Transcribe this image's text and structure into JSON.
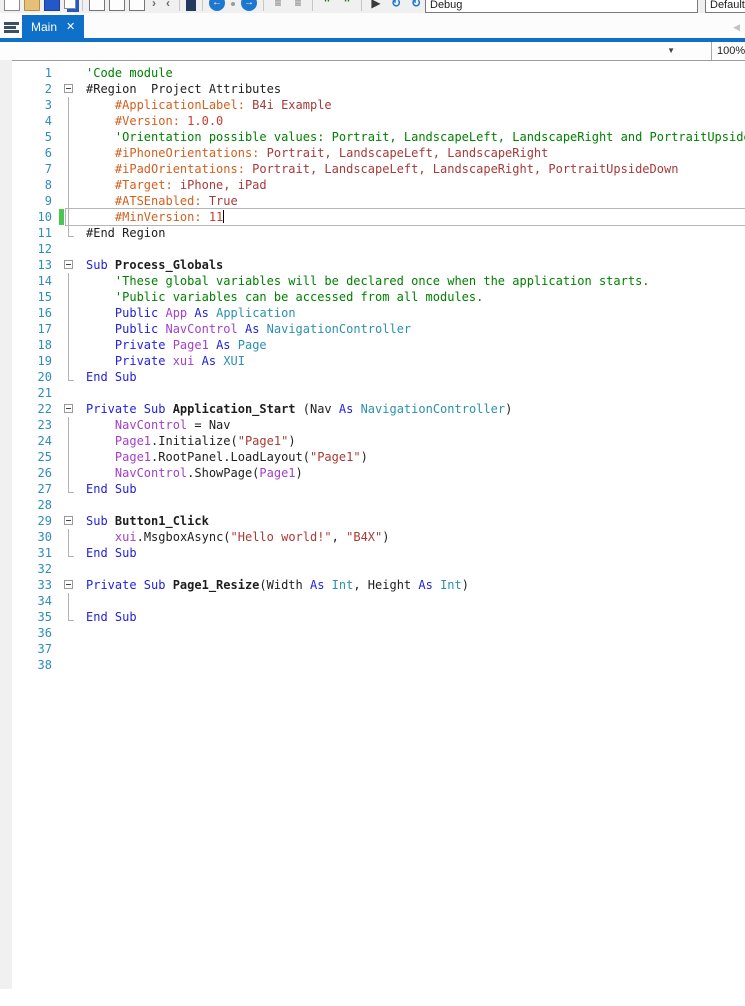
{
  "toolbar": {
    "debug_value": "Debug",
    "default_value": "Default",
    "icons": [
      {
        "name": "new-file",
        "kind": "square",
        "glyph": ""
      },
      {
        "name": "open-project",
        "kind": "folder",
        "glyph": ""
      },
      {
        "name": "save",
        "kind": "save",
        "glyph": ""
      },
      {
        "name": "save-all",
        "kind": "saveall",
        "glyph": ""
      },
      {
        "sep": true
      },
      {
        "name": "designer",
        "kind": "window",
        "glyph": ""
      },
      {
        "name": "modules",
        "kind": "window",
        "glyph": ""
      },
      {
        "name": "logs-panel",
        "kind": "window",
        "glyph": ""
      },
      {
        "name": "match-previous",
        "kind": "chev",
        "glyph": "›"
      },
      {
        "name": "match-next",
        "kind": "chev",
        "glyph": "‹"
      },
      {
        "sep": true
      },
      {
        "name": "bookmark",
        "kind": "bookmark",
        "glyph": ""
      },
      {
        "sep": true
      },
      {
        "name": "navigate-back",
        "kind": "bluecircle",
        "glyph": "←"
      },
      {
        "name": "navigate-dot",
        "kind": "dot",
        "glyph": ""
      },
      {
        "name": "navigate-forward",
        "kind": "bluecircle",
        "glyph": "→"
      },
      {
        "sep": true
      },
      {
        "name": "outdent",
        "kind": "plain",
        "glyph": "≡"
      },
      {
        "name": "indent",
        "kind": "plain",
        "glyph": "≡"
      },
      {
        "sep": true
      },
      {
        "name": "comment",
        "kind": "plain-green",
        "glyph": "''"
      },
      {
        "name": "uncomment",
        "kind": "plain-green",
        "glyph": "''"
      },
      {
        "sep": true
      },
      {
        "name": "run",
        "kind": "plain-dark",
        "glyph": "▶"
      },
      {
        "name": "rebuild",
        "kind": "plain-blue",
        "glyph": "↻"
      },
      {
        "name": "reload",
        "kind": "plain-blue",
        "glyph": "↻"
      },
      {
        "name": "sync",
        "kind": "plain-blue",
        "glyph": "↺"
      },
      {
        "sep": true
      },
      {
        "name": "compare",
        "kind": "plain-gray",
        "glyph": "="
      },
      {
        "name": "refresh",
        "kind": "plain-dark",
        "glyph": "○"
      }
    ]
  },
  "tab_bar": {
    "active_tab": "Main",
    "close_glyph": "✕",
    "scroll_left_glyph": "◀"
  },
  "editor_header": {
    "sub_combobox_value": "",
    "dropdown_glyph": "▼",
    "zoom_level": "100%"
  },
  "colors": {
    "tab_active_bg": "#0e70c8",
    "line_number": "#2e8bc0",
    "changed_line_marker": "#4cc552",
    "comment": "#008000",
    "keyword": "#2222dd",
    "type": "#2b91af",
    "global_variable": "#a440c8",
    "string": "#a93a34",
    "attribute_key": "#d2601e",
    "attribute_value": "#a63a3a",
    "number": "#ce3b30",
    "plain": "#1e1e1e"
  },
  "editor": {
    "current_line": 10,
    "changed_lines": [
      10
    ],
    "fold_regions": [
      {
        "start": 2,
        "end": 11
      },
      {
        "start": 13,
        "end": 20
      },
      {
        "start": 22,
        "end": 27
      },
      {
        "start": 29,
        "end": 31
      },
      {
        "start": 33,
        "end": 35
      }
    ],
    "lines": [
      [
        {
          "t": "'Code module",
          "c": "cm"
        }
      ],
      [
        {
          "t": "#Region  Project Attributes",
          "c": "tx"
        }
      ],
      [
        {
          "t": "    #ApplicationLabel: ",
          "c": "at"
        },
        {
          "t": "B4i Example",
          "c": "av"
        }
      ],
      [
        {
          "t": "    #Version: ",
          "c": "at"
        },
        {
          "t": "1.0.0",
          "c": "nu"
        }
      ],
      [
        {
          "t": "    'Orientation possible values: Portrait, LandscapeLeft, LandscapeRight and PortraitUpsideDown",
          "c": "cm"
        }
      ],
      [
        {
          "t": "    #iPhoneOrientations: ",
          "c": "at"
        },
        {
          "t": "Portrait, LandscapeLeft, LandscapeRight",
          "c": "av"
        }
      ],
      [
        {
          "t": "    #iPadOrientations: ",
          "c": "at"
        },
        {
          "t": "Portrait, LandscapeLeft, LandscapeRight, PortraitUpsideDown",
          "c": "av"
        }
      ],
      [
        {
          "t": "    #Target: ",
          "c": "at"
        },
        {
          "t": "iPhone, iPad",
          "c": "av"
        }
      ],
      [
        {
          "t": "    #ATSEnabled: ",
          "c": "at"
        },
        {
          "t": "True",
          "c": "av"
        }
      ],
      [
        {
          "t": "    #MinVersion: ",
          "c": "at"
        },
        {
          "t": "11",
          "c": "nu"
        },
        {
          "t": "",
          "c": "caret"
        }
      ],
      [
        {
          "t": "#End Region",
          "c": "tx"
        }
      ],
      [],
      [
        {
          "t": "Sub ",
          "c": "kw"
        },
        {
          "t": "Process_Globals",
          "c": "sb"
        }
      ],
      [
        {
          "t": "    'These global variables will be declared once when the application starts.",
          "c": "cm"
        }
      ],
      [
        {
          "t": "    'Public variables can be accessed from all modules.",
          "c": "cm"
        }
      ],
      [
        {
          "t": "    ",
          "c": "tx"
        },
        {
          "t": "Public ",
          "c": "kw"
        },
        {
          "t": "App",
          "c": "gv"
        },
        {
          "t": " ",
          "c": "tx"
        },
        {
          "t": "As ",
          "c": "kw"
        },
        {
          "t": "Application",
          "c": "ty"
        }
      ],
      [
        {
          "t": "    ",
          "c": "tx"
        },
        {
          "t": "Public ",
          "c": "kw"
        },
        {
          "t": "NavControl",
          "c": "gv"
        },
        {
          "t": " ",
          "c": "tx"
        },
        {
          "t": "As ",
          "c": "kw"
        },
        {
          "t": "NavigationController",
          "c": "ty"
        }
      ],
      [
        {
          "t": "    ",
          "c": "tx"
        },
        {
          "t": "Private ",
          "c": "kw"
        },
        {
          "t": "Page1",
          "c": "gv"
        },
        {
          "t": " ",
          "c": "tx"
        },
        {
          "t": "As ",
          "c": "kw"
        },
        {
          "t": "Page",
          "c": "ty"
        }
      ],
      [
        {
          "t": "    ",
          "c": "tx"
        },
        {
          "t": "Private ",
          "c": "kw"
        },
        {
          "t": "xui",
          "c": "gv"
        },
        {
          "t": " ",
          "c": "tx"
        },
        {
          "t": "As ",
          "c": "kw"
        },
        {
          "t": "XUI",
          "c": "ty"
        }
      ],
      [
        {
          "t": "End Sub",
          "c": "kw"
        }
      ],
      [],
      [
        {
          "t": "Private Sub ",
          "c": "kw"
        },
        {
          "t": "Application_Start",
          "c": "sb"
        },
        {
          "t": " (Nav ",
          "c": "tx"
        },
        {
          "t": "As ",
          "c": "kw"
        },
        {
          "t": "NavigationController",
          "c": "ty"
        },
        {
          "t": ")",
          "c": "tx"
        }
      ],
      [
        {
          "t": "    ",
          "c": "tx"
        },
        {
          "t": "NavControl",
          "c": "gv"
        },
        {
          "t": " = Nav",
          "c": "tx"
        }
      ],
      [
        {
          "t": "    ",
          "c": "tx"
        },
        {
          "t": "Page1",
          "c": "gv"
        },
        {
          "t": ".Initialize(",
          "c": "tx"
        },
        {
          "t": "\"Page1\"",
          "c": "st"
        },
        {
          "t": ")",
          "c": "tx"
        }
      ],
      [
        {
          "t": "    ",
          "c": "tx"
        },
        {
          "t": "Page1",
          "c": "gv"
        },
        {
          "t": ".RootPanel.LoadLayout(",
          "c": "tx"
        },
        {
          "t": "\"Page1\"",
          "c": "st"
        },
        {
          "t": ")",
          "c": "tx"
        }
      ],
      [
        {
          "t": "    ",
          "c": "tx"
        },
        {
          "t": "NavControl",
          "c": "gv"
        },
        {
          "t": ".ShowPage(",
          "c": "tx"
        },
        {
          "t": "Page1",
          "c": "gv"
        },
        {
          "t": ")",
          "c": "tx"
        }
      ],
      [
        {
          "t": "End Sub",
          "c": "kw"
        }
      ],
      [],
      [
        {
          "t": "Sub ",
          "c": "kw"
        },
        {
          "t": "Button1_Click",
          "c": "sb"
        }
      ],
      [
        {
          "t": "    ",
          "c": "tx"
        },
        {
          "t": "xui",
          "c": "gv"
        },
        {
          "t": ".MsgboxAsync(",
          "c": "tx"
        },
        {
          "t": "\"Hello world!\"",
          "c": "st"
        },
        {
          "t": ", ",
          "c": "tx"
        },
        {
          "t": "\"B4X\"",
          "c": "st"
        },
        {
          "t": ")",
          "c": "tx"
        }
      ],
      [
        {
          "t": "End Sub",
          "c": "kw"
        }
      ],
      [],
      [
        {
          "t": "Private Sub ",
          "c": "kw"
        },
        {
          "t": "Page1_Resize",
          "c": "sb"
        },
        {
          "t": "(Width ",
          "c": "tx"
        },
        {
          "t": "As ",
          "c": "kw"
        },
        {
          "t": "Int",
          "c": "ty"
        },
        {
          "t": ", Height ",
          "c": "tx"
        },
        {
          "t": "As ",
          "c": "kw"
        },
        {
          "t": "Int",
          "c": "ty"
        },
        {
          "t": ")",
          "c": "tx"
        }
      ],
      [],
      [
        {
          "t": "End Sub",
          "c": "kw"
        }
      ],
      [],
      [],
      []
    ]
  }
}
